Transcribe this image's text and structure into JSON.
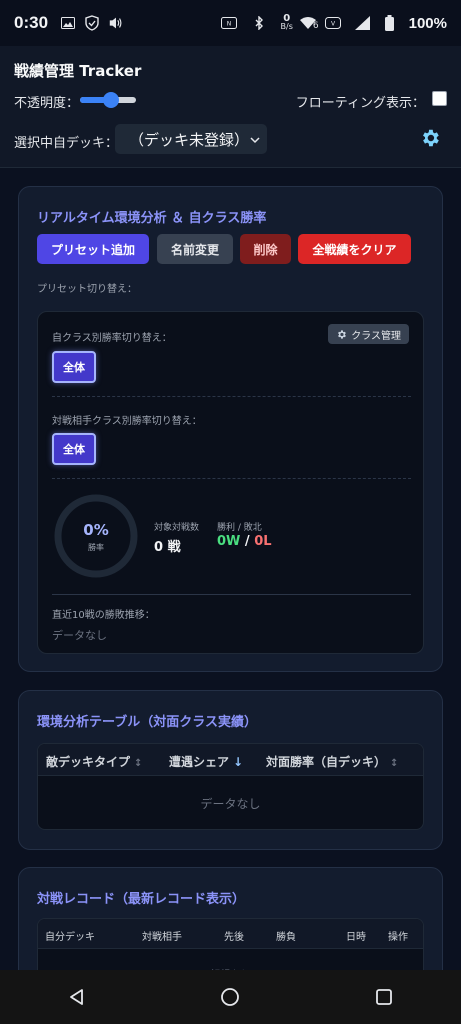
{
  "status_bar": {
    "time": "0:30",
    "net_speed_top": "0",
    "net_speed_unit": "B/s",
    "net_type": "6",
    "battery": "100%"
  },
  "header": {
    "title": "戦績管理 Tracker",
    "opacity_label": "不透明度：",
    "opacity_value_pct": 55,
    "floating_label": "フローティング表示：",
    "floating_checked": false,
    "deck_label": "選択中自デッキ：",
    "deck_selected": "（デッキ未登録）"
  },
  "analysis": {
    "title": "リアルタイム環境分析 ＆ 自クラス勝率",
    "buttons": {
      "add_preset": "プリセット追加",
      "rename": "名前変更",
      "delete": "削除",
      "clear_all": "全戦績をクリア"
    },
    "preset_switch_label": "プリセット切り替え：",
    "own_class_label": "自クラス別勝率切り替え：",
    "class_manage_button": "クラス管理",
    "own_all_button": "全体",
    "opp_class_label": "対戦相手クラス別勝率切り替え：",
    "opp_all_button": "全体",
    "winrate_pct": "0%",
    "winrate_sub": "勝率",
    "winrate_value": 0,
    "total_label": "対象対戦数",
    "total_value": "0 戦",
    "wl_label": "勝利 / 敗北",
    "wins": "0W",
    "wl_sep": " / ",
    "losses": "0L",
    "recent_label": "直近10戦の勝敗推移：",
    "recent_empty": "データなし"
  },
  "env_table": {
    "title": "環境分析テーブル（対面クラス実績）",
    "columns": [
      "敵デッキタイプ",
      "遭遇シェア",
      "対面勝率（自デッキ）"
    ],
    "sort_icons": [
      "↕",
      "↓",
      "↕"
    ],
    "empty": "データなし"
  },
  "records": {
    "title": "対戦レコード（最新レコード表示）",
    "columns": [
      "自分デッキ",
      "対戦相手",
      "先後",
      "勝負",
      "日時",
      "操作"
    ],
    "empty_partial": "記録なし"
  },
  "colors": {
    "accent": "#4f46e5",
    "title_accent": "#8b93f8",
    "danger": "#dc2626",
    "win": "#4ade80",
    "loss": "#f87171"
  }
}
